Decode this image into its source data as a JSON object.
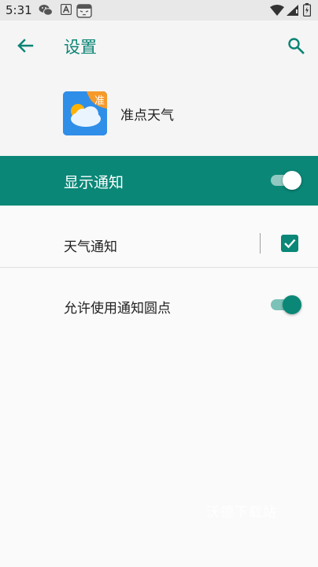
{
  "status_bar": {
    "time": "5:31",
    "icons": [
      "wechat-icon",
      "a-box-icon",
      "robot-face-icon",
      "wifi-icon",
      "signal-icon",
      "battery-icon"
    ]
  },
  "app_bar": {
    "title": "设置",
    "back_icon": "arrow-back-icon",
    "search_icon": "search-icon"
  },
  "app_header": {
    "app_name": "准点天气",
    "badge_text": "准"
  },
  "master_switch": {
    "label": "显示通知",
    "on": true
  },
  "settings": [
    {
      "label": "天气通知",
      "control": "checkbox",
      "checked": true
    },
    {
      "label": "允许使用通知圆点",
      "control": "switch",
      "on": true
    }
  ],
  "watermark": "沃德下载站",
  "colors": {
    "accent": "#0a8777",
    "title_teal": "#0b8475",
    "background": "#fafafa"
  }
}
